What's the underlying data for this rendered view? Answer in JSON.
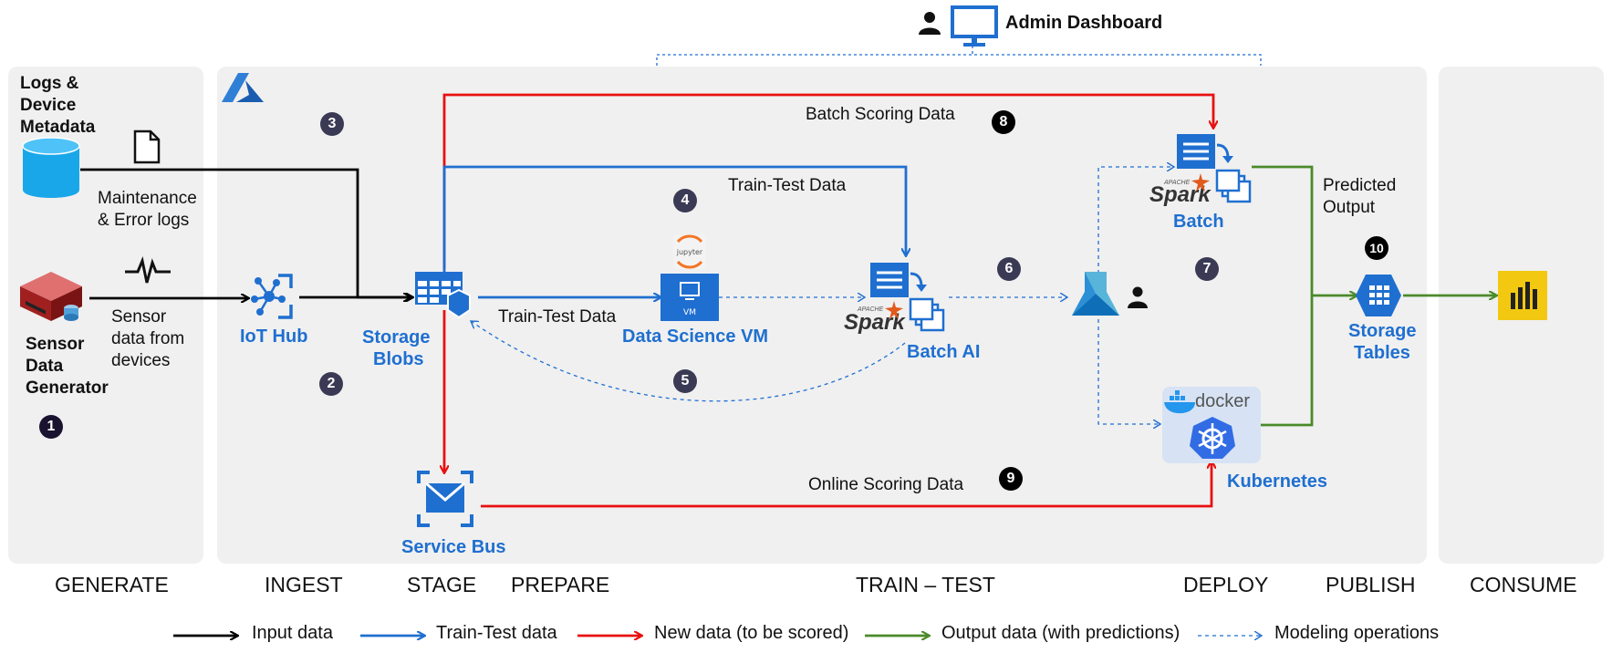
{
  "admin": {
    "label": "Admin Dashboard"
  },
  "generate": {
    "logs_label_1": "Logs &",
    "logs_label_2": "Device",
    "logs_label_3": "Metadata",
    "maint_1": "Maintenance",
    "maint_2": "& Error logs",
    "sensor_1": "Sensor",
    "sensor_2": "data from",
    "sensor_3": "devices",
    "gen_1": "Sensor",
    "gen_2": "Data",
    "gen_3": "Generator"
  },
  "nodes": {
    "iot_hub": "IoT Hub",
    "storage_blobs_1": "Storage",
    "storage_blobs_2": "Blobs",
    "service_bus": "Service Bus",
    "dsvm": "Data Science VM",
    "batch_ai": "Batch AI",
    "batch": "Batch",
    "kubernetes": "Kubernetes",
    "storage_tables_1": "Storage",
    "storage_tables_2": "Tables",
    "jupyter": "jupyter",
    "vm": "VM",
    "docker": "docker",
    "spark": "Spark",
    "spark_apache": "APACHE"
  },
  "edges": {
    "batch_scoring": "Batch Scoring Data",
    "train_test_top": "Train-Test Data",
    "train_test_mid": "Train-Test Data",
    "online_scoring": "Online Scoring Data",
    "predicted_1": "Predicted",
    "predicted_2": "Output"
  },
  "steps": [
    "1",
    "2",
    "3",
    "4",
    "5",
    "6",
    "7",
    "8",
    "9",
    "10"
  ],
  "stages": [
    "GENERATE",
    "INGEST",
    "STAGE",
    "PREPARE",
    "TRAIN – TEST",
    "DEPLOY",
    "PUBLISH",
    "CONSUME"
  ],
  "legend": [
    {
      "label": "Input data",
      "color": "#000000",
      "style": "solid"
    },
    {
      "label": "Train-Test data",
      "color": "#1f6fd0",
      "style": "solid"
    },
    {
      "label": "New data (to be scored)",
      "color": "#e81010",
      "style": "solid"
    },
    {
      "label": "Output data (with predictions)",
      "color": "#4a8a2a",
      "style": "solid"
    },
    {
      "label": "Modeling operations",
      "color": "#1f6fd0",
      "style": "dashed"
    }
  ],
  "colors": {
    "input": "#000000",
    "train": "#1f6fd0",
    "new": "#e81010",
    "output": "#4a8a2a",
    "accent": "#1f6fd0"
  }
}
